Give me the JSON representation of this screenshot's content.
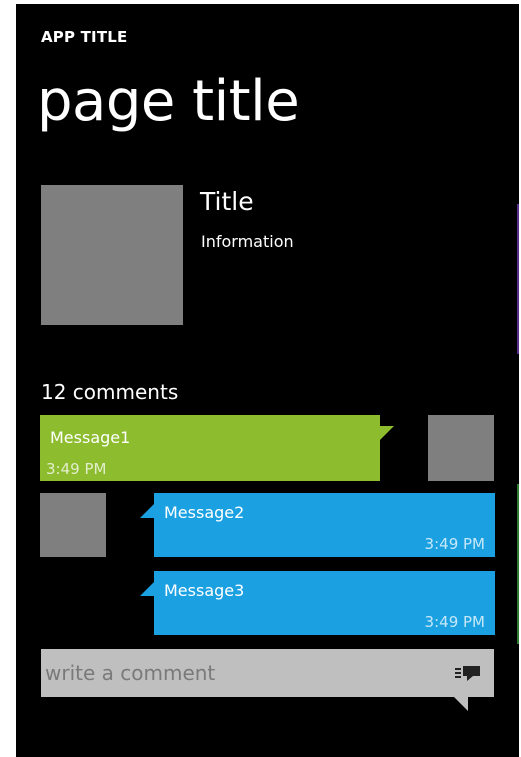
{
  "header": {
    "app_title": "APP TITLE",
    "page_title": "page title"
  },
  "item": {
    "title": "Title",
    "info": "Information"
  },
  "comments": {
    "count_label": "12 comments",
    "messages": [
      {
        "text": "Message1",
        "time": "3:49 PM",
        "color": "#8dbc2f",
        "side": "left"
      },
      {
        "text": "Message2",
        "time": "3:49 PM",
        "color": "#1ba1e2",
        "side": "right"
      },
      {
        "text": "Message3",
        "time": "3:49 PM",
        "color": "#1ba1e2",
        "side": "right"
      }
    ]
  },
  "composer": {
    "placeholder": "write a comment",
    "send_icon": "send-comment-icon"
  },
  "theme": {
    "background": "#000000",
    "accent_green": "#8dbc2f",
    "accent_blue": "#1ba1e2",
    "placeholder_gray": "#7f7f7f",
    "input_background": "#bfbfbf"
  }
}
